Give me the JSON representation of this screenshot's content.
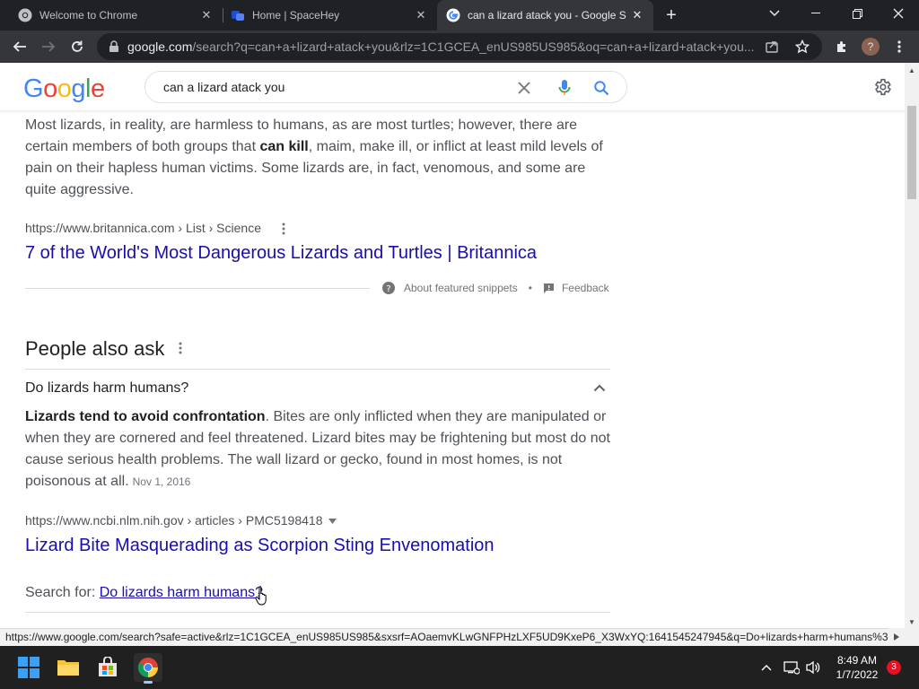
{
  "browser": {
    "tabs": [
      {
        "title": "Welcome to Chrome",
        "icon": "chrome-icon",
        "active": false
      },
      {
        "title": "Home | SpaceHey",
        "icon": "spacehey-icon",
        "active": false
      },
      {
        "title": "can a lizard atack you - Google S",
        "icon": "google-icon",
        "active": true
      }
    ],
    "url_host": "google.com",
    "url_path": "/search?q=can+a+lizard+atack+you&rlz=1C1GCEA_enUS985US985&oq=can+a+lizard+atack+you...",
    "profile_initial": "?"
  },
  "google": {
    "logo": "Google",
    "query": "can a lizard atack you"
  },
  "featured_snippet": {
    "text_before": "Most lizards, in reality, are harmless to humans, as are most turtles; however, there are certain members of both groups that ",
    "bold": "can kill",
    "text_after": ", maim, make ill, or inflict at least mild levels of pain on their hapless human victims. Some lizards are, in fact, venomous, and some are quite aggressive.",
    "cite": "https://www.britannica.com › List › Science",
    "title": "7 of the World's Most Dangerous Lizards and Turtles | Britannica",
    "about_label": "About featured snippets",
    "separator": "•",
    "feedback_label": "Feedback"
  },
  "people_also_ask": {
    "title": "People also ask",
    "question": "Do lizards harm humans?",
    "answer_bold": "Lizards tend to avoid confrontation",
    "answer_rest": ". Bites are only inflicted when they are manipulated or when they are cornered and feel threatened. Lizard bites may be frightening but most do not cause serious health problems. The wall lizard or gecko, found in most homes, is not poisonous at all.",
    "date": "Nov 1, 2016",
    "cite": "https://www.ncbi.nlm.nih.gov › articles › PMC5198418",
    "result_title": "Lizard Bite Masquerading as Scorpion Sting Envenomation",
    "search_for_label": "Search for: ",
    "search_for_link": "Do lizards harm humans?"
  },
  "status_url": "https://www.google.com/search?safe=active&rlz=1C1GCEA_enUS985US985&sxsrf=AOaemvKLwGNFPHzLXF5UD9KxeP6_X3WxYQ:1641545247945&q=Do+lizards+harm+humans%3F&...",
  "taskbar": {
    "time": "8:49 AM",
    "date": "1/7/2022",
    "notifications": "3"
  },
  "colors": {
    "link": "#1a0dab",
    "chrome_dark": "#202124",
    "google_blue": "#4285f4",
    "google_red": "#ea4335",
    "google_yellow": "#fbbc05",
    "google_green": "#34a853"
  }
}
